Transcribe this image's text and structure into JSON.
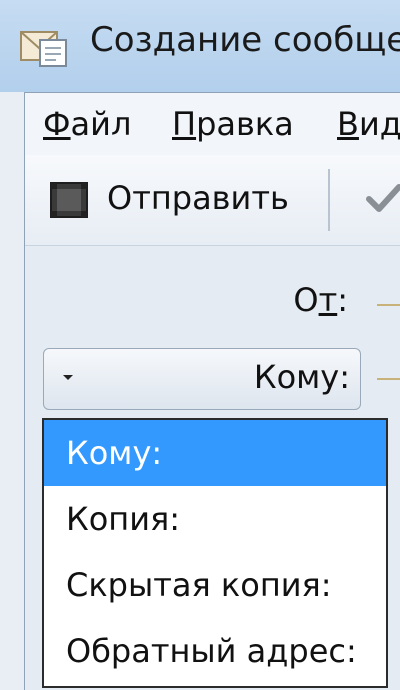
{
  "window": {
    "title": "Создание сообще",
    "icon": "compose-message-icon"
  },
  "menu": {
    "items": [
      {
        "accel": "Ф",
        "rest": "айл"
      },
      {
        "accel": "П",
        "rest": "равка"
      },
      {
        "accel": "В",
        "rest": "ид"
      }
    ]
  },
  "toolbar": {
    "send_label": "Отправить",
    "send_icon": "send-icon",
    "check_icon": "spellcheck-icon"
  },
  "header": {
    "from": {
      "before": "О",
      "accel": "т",
      "after": ":"
    },
    "recipient_type": "Кому:"
  },
  "dropdown": {
    "options": [
      "Кому:",
      "Копия:",
      "Скрытая копия:",
      "Обратный адрес:"
    ],
    "selected_index": 0
  },
  "colors": {
    "selection": "#3399ff",
    "titlebar": "#b2cfec"
  }
}
